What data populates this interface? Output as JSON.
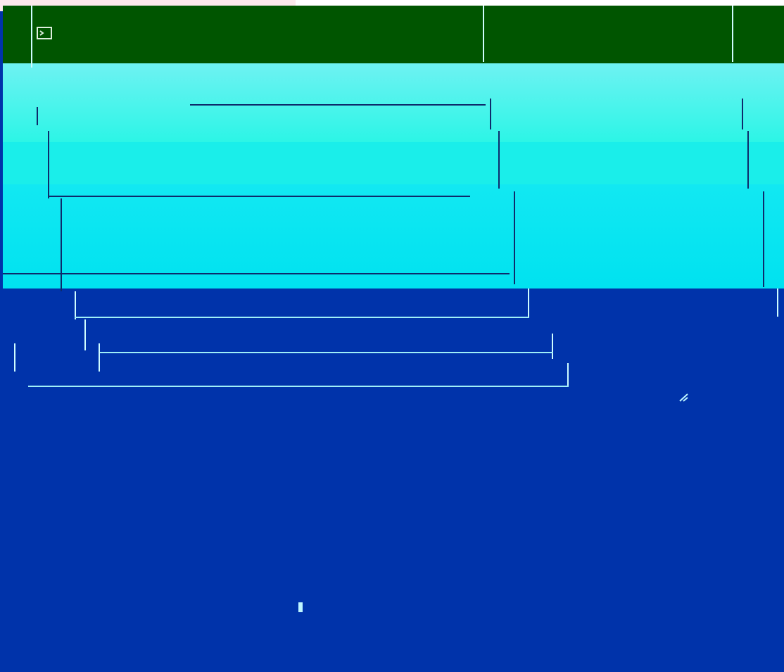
{
  "window": {
    "title": "",
    "app_icon": "terminal-icon",
    "status_line": ""
  },
  "lines": [
    {
      "id": "l1",
      "text": ""
    },
    {
      "id": "l2",
      "text": ""
    },
    {
      "id": "l3",
      "text": ""
    },
    {
      "id": "l4",
      "text": ""
    },
    {
      "id": "l5",
      "text": ""
    },
    {
      "id": "l6",
      "text": ""
    },
    {
      "id": "l7",
      "text": ""
    },
    {
      "id": "l8",
      "text": ""
    },
    {
      "id": "l9",
      "text": ""
    },
    {
      "id": "l10",
      "text": ""
    },
    {
      "id": "l11",
      "text": ""
    }
  ],
  "side_labels": {
    "left_top": "",
    "left_mid": "",
    "right_top": ""
  },
  "colors": {
    "title_bg": "#005500",
    "cyan_band": "#1AEEEA",
    "main_bg": "#0033AA",
    "text_dark": "#0A2C78",
    "text_light": "#BFF6FF"
  }
}
